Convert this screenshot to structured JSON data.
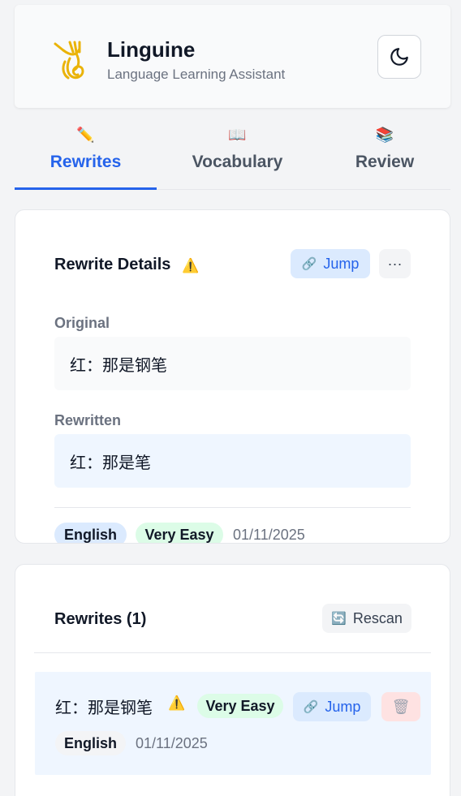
{
  "header": {
    "title": "Linguine",
    "subtitle": "Language Learning Assistant",
    "logo_icon": "fork-pasta-icon",
    "theme_icon": "moon-icon"
  },
  "tabs": [
    {
      "label": "Rewrites",
      "icon": "✏️",
      "active": true
    },
    {
      "label": "Vocabulary",
      "icon": "📖",
      "active": false
    },
    {
      "label": "Review",
      "icon": "📚",
      "active": false
    }
  ],
  "details": {
    "title": "Rewrite Details",
    "warning_icon": "⚠️",
    "jump_icon": "🔗",
    "jump_label": "Jump",
    "more_label": "···",
    "original_label": "Original",
    "original_text": "红：那是钢笔",
    "rewritten_label": "Rewritten",
    "rewritten_text": "红：那是笔",
    "language": "English",
    "difficulty": "Very Easy",
    "date": "01/11/2025"
  },
  "list": {
    "title": "Rewrites (1)",
    "rescan_icon": "🔄",
    "rescan_label": "Rescan",
    "items": [
      {
        "text": "红：那是钢笔",
        "warning_icon": "⚠️",
        "difficulty": "Very Easy",
        "jump_icon": "🔗",
        "jump_label": "Jump",
        "delete_icon": "🗑",
        "language": "English",
        "date": "01/11/2025"
      }
    ]
  },
  "colors": {
    "accent": "#2563eb",
    "jump_bg": "#dbeafe",
    "easy_bg": "#dcfce7",
    "delete_bg": "#fee2e2",
    "logo": "#eab308"
  }
}
